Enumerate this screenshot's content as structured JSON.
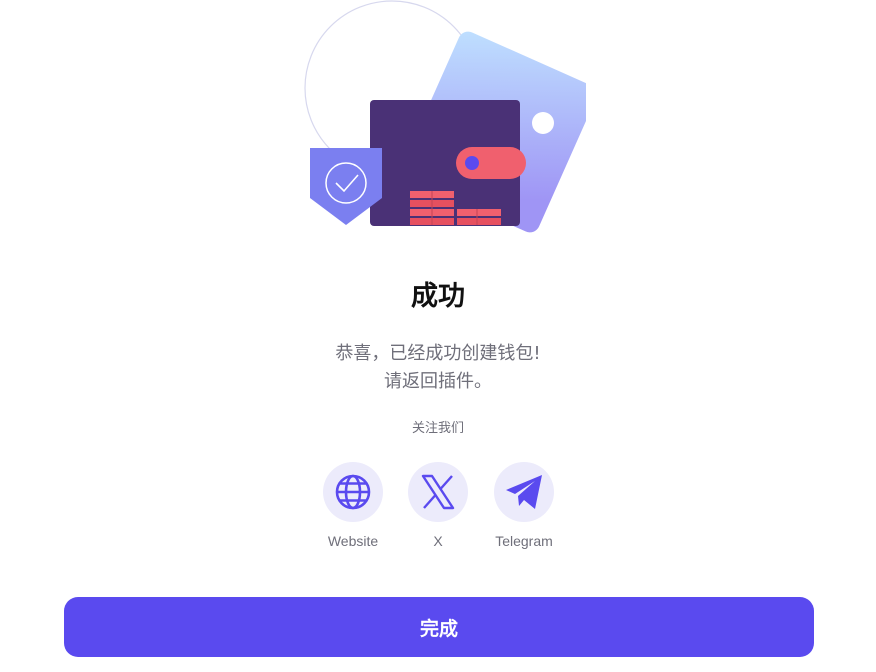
{
  "success": {
    "title": "成功",
    "message_line1": "恭喜，已经成功创建钱包!",
    "message_line2": "请返回插件。"
  },
  "follow": {
    "label": "关注我们",
    "links": [
      {
        "label": "Website",
        "icon": "globe-icon"
      },
      {
        "label": "X",
        "icon": "x-logo-icon"
      },
      {
        "label": "Telegram",
        "icon": "telegram-icon"
      }
    ]
  },
  "actions": {
    "done_label": "完成"
  },
  "colors": {
    "accent": "#5a4aef",
    "icon_bg": "#ecebfb",
    "wallet": "#4a3176",
    "shield": "#7b7ff0",
    "coins": "#f0606e",
    "card": "#b3c5ff"
  }
}
